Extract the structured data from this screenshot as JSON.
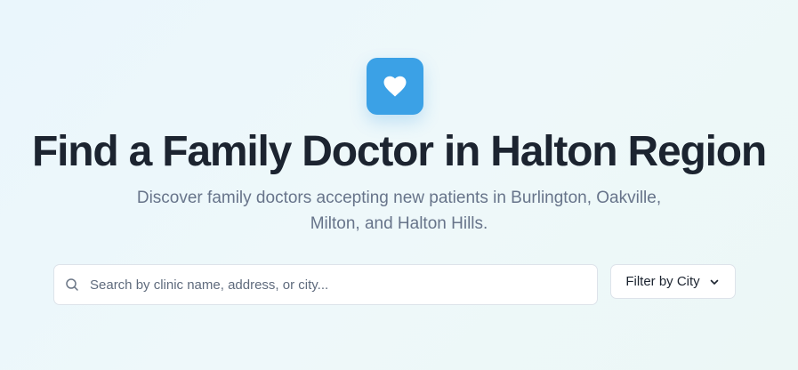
{
  "hero": {
    "title": "Find a Family Doctor in Halton Region",
    "subtitle": "Discover family doctors accepting new patients in Burlington, Oakville, Milton, and Halton Hills.",
    "logo_icon": "heart-icon"
  },
  "search": {
    "placeholder": "Search by clinic name, address, or city...",
    "value": "",
    "icon": "search-icon"
  },
  "filter": {
    "label": "Filter by City",
    "icon": "chevron-down-icon"
  },
  "colors": {
    "accent": "#3ba1e6",
    "title": "#1c2430",
    "subtitle": "#67748a",
    "border": "#dde3ea"
  }
}
